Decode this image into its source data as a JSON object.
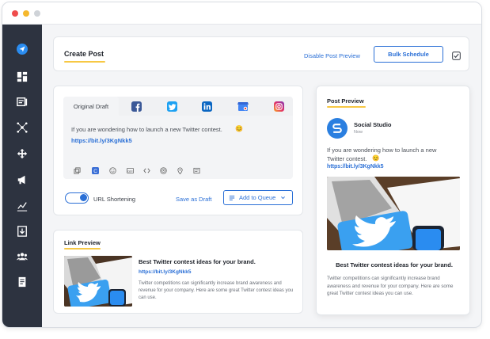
{
  "header": {
    "title": "Create Post",
    "disable_preview": "Disable Post Preview",
    "bulk_schedule": "Bulk Schedule"
  },
  "editor": {
    "tab_original": "Original Draft",
    "text": "If you are wondering how to launch a new Twitter contest.",
    "link": "https://bit.ly/3KgNkk5",
    "url_shortening": "URL Shortening",
    "save_draft": "Save as Draft",
    "add_to_queue": "Add to Queue"
  },
  "link_preview": {
    "title": "Link Preview",
    "headline": "Best Twitter contest ideas for your brand.",
    "link": "https://bit.ly/3KgNkk5",
    "description": "Twitter competitions can significantly increase brand awareness and revenue for your company. Here are some great Twitter contest ideas you can use."
  },
  "post_preview": {
    "title": "Post Preview",
    "account_name": "Social Studio",
    "account_time": "Now",
    "text": "If you are wondering how to launch a new Twitter contest.",
    "link": "https://bit.ly/3KgNkk5",
    "headline": "Best Twitter contest ideas for your brand.",
    "description": "Twitter competitions can significantly increase brand awareness and revenue for your company. Here are some great Twitter contest ideas you can use."
  },
  "colors": {
    "accent": "#2a6fd6",
    "sidebar": "#2d3340",
    "underline": "#f7c844"
  },
  "icons": {
    "sidebar": [
      "send-icon",
      "dashboard-icon",
      "compose-icon",
      "network-icon",
      "move-icon",
      "megaphone-icon",
      "analytics-icon",
      "download-icon",
      "team-icon",
      "document-icon"
    ],
    "networks": [
      "facebook-icon",
      "twitter-icon",
      "linkedin-icon",
      "google-business-icon",
      "instagram-icon"
    ]
  }
}
